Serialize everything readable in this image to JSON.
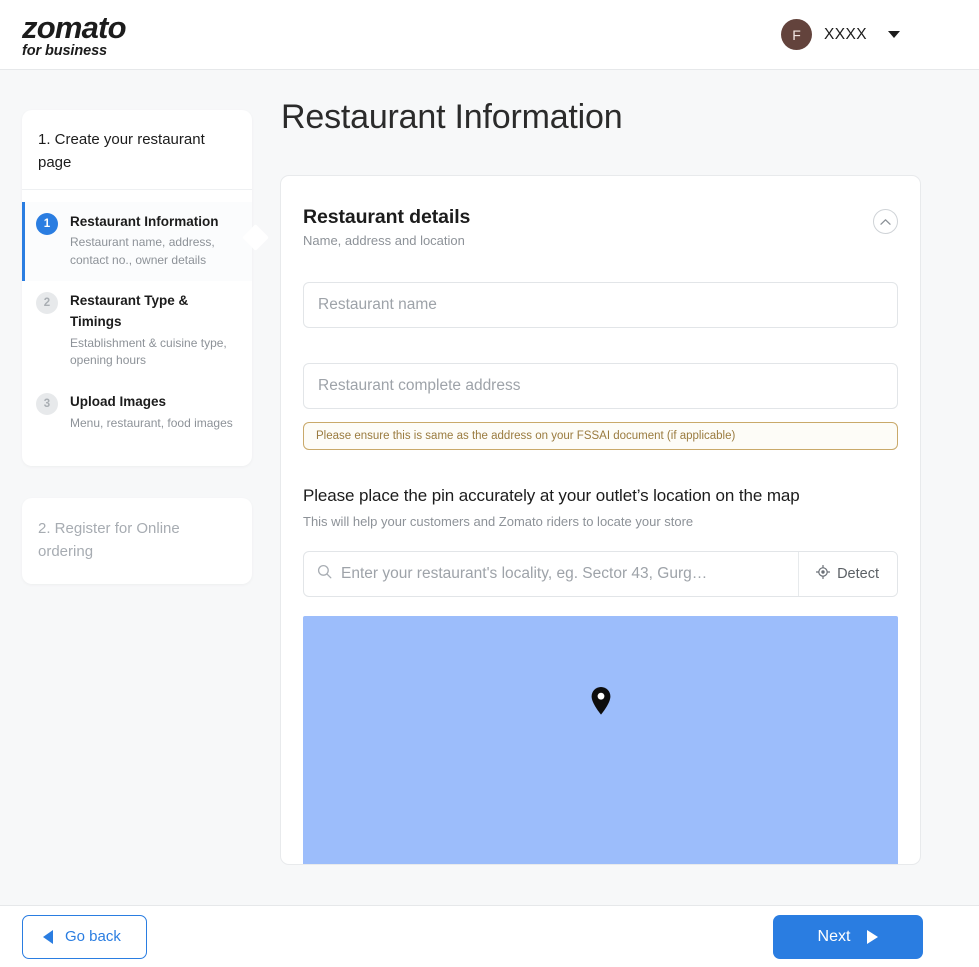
{
  "header": {
    "brand_main": "zomato",
    "brand_sub": "for business",
    "avatar_initial": "F",
    "user_name": "XXXX",
    "caret_icon": "chevron-down-icon"
  },
  "sidebar": {
    "primary": {
      "title": "1. Create your restaurant page",
      "steps": [
        {
          "number": "1",
          "label": "Restaurant Information",
          "desc": "Restaurant name, address, contact no., owner details",
          "active": true
        },
        {
          "number": "2",
          "label": "Restaurant Type & Timings",
          "desc": "Establishment & cuisine type, opening hours",
          "active": false
        },
        {
          "number": "3",
          "label": "Upload Images",
          "desc": "Menu, restaurant, food images",
          "active": false
        }
      ]
    },
    "secondary": {
      "title": "2. Register for Online ordering"
    }
  },
  "main": {
    "page_title": "Restaurant Information",
    "card": {
      "title": "Restaurant details",
      "subtitle": "Name, address and location",
      "collapse_icon": "chevron-up-icon",
      "restaurant_name_placeholder": "Restaurant name",
      "restaurant_name_value": "",
      "restaurant_address_placeholder": "Restaurant complete address",
      "restaurant_address_value": "",
      "fssai_notice": "Please ensure this is same as the address on your FSSAI document (if applicable)",
      "map_heading": "Please place the pin accurately at your outlet’s location on the map",
      "map_subheading": "This will help your customers and Zomato riders to locate your store",
      "locality_placeholder": "Enter your restaurant's locality, eg. Sector 43, Gurg…",
      "locality_value": "",
      "search_icon": "search-icon",
      "detect_label": "Detect",
      "detect_icon": "crosshair-icon",
      "map_pin_icon": "map-pin-icon",
      "map_color": "#9cbdfb"
    }
  },
  "footer": {
    "go_back_label": "Go back",
    "go_back_icon": "triangle-left-icon",
    "next_label": "Next",
    "next_icon": "triangle-right-icon"
  },
  "colors": {
    "accent_blue": "#2a7de1",
    "avatar_brown": "#63433c",
    "notice_border": "#c9a96a",
    "notice_text": "#9a7b3f",
    "page_background": "#f7f8f9"
  }
}
